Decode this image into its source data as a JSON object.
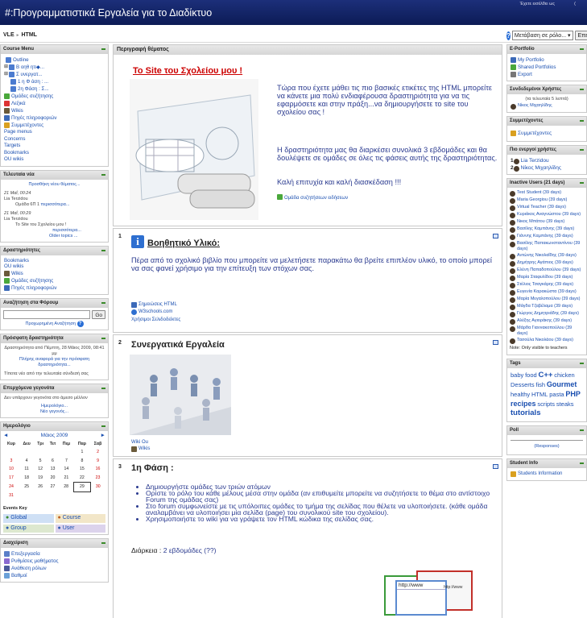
{
  "header": {
    "title": "#:Προγραμματιστικά Εργαλεία για το Διαδίκτυο",
    "user_text": "Έχετε εισέλθει ως",
    "user_text2": "("
  },
  "nav": {
    "crumb1": "VLE",
    "sep": "►",
    "crumb2": "HTML",
    "jump_select": "Μετάβαση σε ρόλο...",
    "edit_button": "Επεξεργασί"
  },
  "left": {
    "course_menu": {
      "title": "Course Menu",
      "items": [
        "Outline",
        "Β οηθ ητι◆...",
        "Σ υνεργατ...",
        "1 η Φ άση : ...",
        "2η Φάση : Σ...",
        "Ομάδες συζήτησης",
        "Λεξικά",
        "Wikis",
        "Πηγές πληροφοριών",
        "Συμμετέχοντες"
      ],
      "plain": [
        "Page menus",
        "Concerns",
        "Targets",
        "Bookmarks",
        "OU wikis"
      ]
    },
    "news": {
      "title": "Τελευταία νέα",
      "add": "Προσθήκη νέου θέματος...",
      "items": [
        {
          "date": "21 Μαΐ, 00:24",
          "name": "Lia Terzidou",
          "text": "Ομάδα 6Π 1",
          "more": "περισσότερα..."
        },
        {
          "date": "21 Μαΐ, 00:29",
          "name": "Lia Terzidou",
          "text": "Το Site του Σχολείου μου !",
          "more": "περισσότερα...",
          "older": "Older topics ..."
        }
      ]
    },
    "activities": {
      "title": "Δραστηριότητες",
      "items": [
        "Bookmarks",
        "OU wikis",
        "Wikis",
        "Ομάδες συζήτησης",
        "Πηγές πληροφοριών"
      ]
    },
    "search": {
      "title": "Αναζήτηση στα Φόρουμ",
      "go": "Go",
      "advanced": "Προχωρημένη Αναζήτηση"
    },
    "recent": {
      "title": "Πρόσφατη δραστηριότητα",
      "line1": "Δραστηριότητα από Πέμπτη, 28 Μάιος 2009, 08:41 μμ",
      "link": "Πλήρης αναφορά για την πρόσφατη δραστηριότητα...",
      "none": "Τίποτα νέο από την τελευταία σύνδεσή σας"
    },
    "upcoming": {
      "title": "Επερχόμενα γεγονότα",
      "text": "Δεν υπάρχουν γεγονότα στο άμεσο μέλλον",
      "l1": "Ημερολόγιο...",
      "l2": "Νέο γεγονός..."
    },
    "calendar": {
      "title": "Ημερολόγιο",
      "month": "Μάιος 2009",
      "prev": "◄",
      "next": "►",
      "days": [
        "Κυρ",
        "Δευ",
        "Τρι",
        "Τετ",
        "Πεμ",
        "Παρ",
        "Σαβ"
      ],
      "weeks": [
        [
          "",
          "",
          "",
          "",
          "",
          "1",
          "2"
        ],
        [
          "3",
          "4",
          "5",
          "6",
          "7",
          "8",
          "9"
        ],
        [
          "10",
          "11",
          "12",
          "13",
          "14",
          "15",
          "16"
        ],
        [
          "17",
          "18",
          "19",
          "20",
          "21",
          "22",
          "23"
        ],
        [
          "24",
          "25",
          "26",
          "27",
          "28",
          "29",
          "30"
        ],
        [
          "31",
          "",
          "",
          "",
          "",
          "",
          ""
        ]
      ],
      "key_title": "Events Key",
      "keys": [
        "Global",
        "Course",
        "Group",
        "User"
      ]
    },
    "admin": {
      "title": "Διαχείριση",
      "items": [
        "Επεξεργασία",
        "Ρυθμίσεις μαθήματος",
        "Ανάθεση ρόλων",
        "Βαθμοί"
      ]
    }
  },
  "main": {
    "topic_header": "Περιγραφή θέματος",
    "site_title": "Το Site του Σχολείου μου !",
    "site_text": "Τώρα που έχετε μάθει τις πιο βασικές ετικέτες της HTML μπορείτε να κάνετε μια πολύ ενδιαφέρουσα δραστηριότητα για να τις εφαρμόσετε και στην πράξη...να δημιουργήσετε το site του σχολείου σας !",
    "site_text2": "Η δραστηριότητα μας θα διαρκέσει συνολικά 3 εβδομάδες και θα δουλέψετε σε ομάδες σε όλες τις φάσεις αυτής της δραστηριότητας.",
    "site_text3": "Καλή επιτυχία και καλή διασκέδαση !!!",
    "forum_link": "Ομάδα συζητήσεων ειδήσεων",
    "s1": {
      "num": "1",
      "title": "Βοηθητικό Υλικό:",
      "text": "Πέρα από το σχολικό βιβλίο που μπορείτε να μελετήσετε παρακάτω θα βρείτε επιπλέον υλικό, το οποίο μπορεί να σας φανεί χρήσιμο για την επίτευξη των στόχων σας.",
      "links": [
        "Σημειώσεις HTML",
        "W3schools.com",
        "Χρήσιμοι Σελιδοδείκτες"
      ]
    },
    "s2": {
      "num": "2",
      "title": "Συνεργατικά Εργαλεία",
      "links": [
        "Wiki Ou",
        "Wikis"
      ]
    },
    "s3": {
      "num": "3",
      "title": "1η Φάση :",
      "bullets": [
        "Δημιουργήστε ομάδες των τριών ατόμων",
        "Ορίστε το ρόλο του κάθε μέλους μέσα στην ομάδα (αν επιθυμείτε μπορείτε να συζητήσετε το θέμα στο αντίστοιχο Forum της ομάδας σας)",
        "Στο forum συμφωνείστε με τις υπόλοιπες ομάδες το τμήμα της σελίδας που θέλετε να υλοποιήσετε. (κάθε ομάδα αναλαμβάνει να υλοποιήσει μία σελίδα (page) του συνολικού site του σχολείου).",
        "Χρησιμοποιήστε το wiki για να γράψετε τον HTML κώδικα της σελίδας σας."
      ],
      "duration_label": "Διάρκεια :",
      "duration": "2 εβδομάδες (??)",
      "url1": "http://www",
      "url2": "http://www"
    }
  },
  "right": {
    "eportfolio": {
      "title": "E-Portfolio",
      "items": [
        "My Portfolio",
        "Shared Portfolios",
        "Export"
      ]
    },
    "online": {
      "title": "Συνδεδεμένοι Χρήστες",
      "note": "(τα τελευταία 5 λεπτά)",
      "user": "Νίκος Μιχαηλίδης"
    },
    "participants": {
      "title": "Συμμετέχοντες",
      "link": "Συμμετέχοντες"
    },
    "active": {
      "title": "Πιο ενεργοί χρήστες",
      "users": [
        "Lia Terzidou",
        "Νίκος Μιχαηλίδης"
      ],
      "ranks": [
        "1",
        "2"
      ]
    },
    "inactive": {
      "title": "Inactive Users (21 days)",
      "users": [
        "Test Student (39 days)",
        "Maria Georgiou (39 days)",
        "Virtual Teacher (39 days)",
        "Κυριάκος Αναγνώστου (39 days)",
        "Νικος Μπάτου (39 days)",
        "Βασίλης Καμπάνης (39 days)",
        "Γιάννης Καμπάνης (39 days)",
        "Βασίλης Παπακωνσταντίνου (39 days)",
        "Αντώνης Νικολαΐδης (39 days)",
        "Δημήτρης Αγάπιος (39 days)",
        "Ελένη Παπαδοπούλου (39 days)",
        "Μαρία Σταφυλίδου (39 days)",
        "Στέλιος Τσαγκάρης (39 days)",
        "Ευγενία Καρακώστα (39 days)",
        "Μαρία Μεγαλοπούλου (39 days)",
        "Μάγδα Τζαβέλαμα (39 days)",
        "Γιώργος Δημητριάδης (39 days)",
        "Αλέξης Αγιοράκης (39 days)",
        "Μάρθα Γιαννακοπούλου (39 days)",
        "Τασούλα Νικολάου (39 days)"
      ],
      "note": "Note: Only visible to teachers"
    },
    "tags": {
      "title": "Tags",
      "items": [
        {
          "t": "baby",
          "s": 7.5,
          "b": false
        },
        {
          "t": "food",
          "s": 7.5,
          "b": false
        },
        {
          "t": "C++",
          "s": 9.5,
          "b": true
        },
        {
          "t": "chicken",
          "s": 7.5,
          "b": false
        },
        {
          "t": "Desserts",
          "s": 7.5,
          "b": false
        },
        {
          "t": "fish",
          "s": 7.5,
          "b": false
        },
        {
          "t": "Gourmet",
          "s": 9,
          "b": true
        },
        {
          "t": "healthy",
          "s": 7.5,
          "b": false
        },
        {
          "t": "HTML",
          "s": 7.5,
          "b": false
        },
        {
          "t": "pasta",
          "s": 7.5,
          "b": false
        },
        {
          "t": "PHP",
          "s": 9,
          "b": true
        },
        {
          "t": "recipes",
          "s": 9,
          "b": true
        },
        {
          "t": "scripts",
          "s": 7.5,
          "b": false
        },
        {
          "t": "steaks",
          "s": 7.5,
          "b": false
        },
        {
          "t": "tutorials",
          "s": 9.5,
          "b": true
        }
      ]
    },
    "poll": {
      "title": "Poll",
      "link": "(Responses)"
    },
    "student": {
      "title": "Student Info",
      "link": "Students Information"
    }
  }
}
